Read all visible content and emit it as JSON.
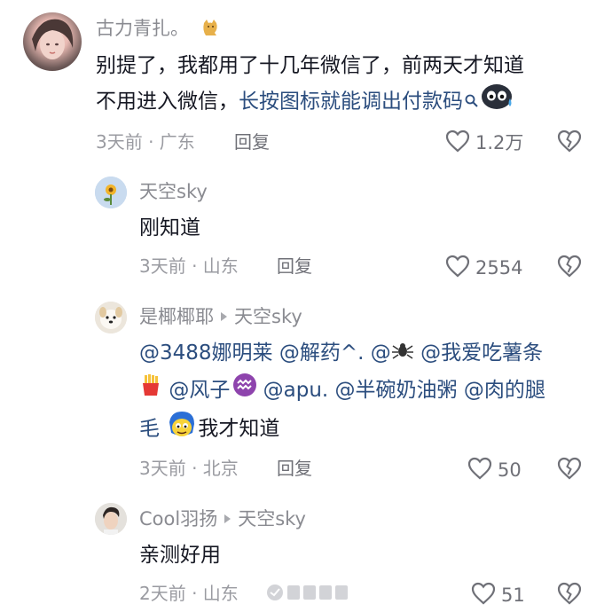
{
  "comments": [
    {
      "username": "古力青扎。",
      "text_line1": "别提了，我都用了十几年微信了，前两天才知道",
      "text_line2_prefix": "不用进入微信，",
      "text_line2_link": "长按图标就能调出付款码",
      "time_location": "3天前 · 广东",
      "reply_label": "回复",
      "likes": "1.2万"
    },
    {
      "username": "天空sky",
      "text": "刚知道",
      "time_location": "3天前 · 山东",
      "reply_label": "回复",
      "likes": "2554"
    },
    {
      "username": "是椰椰耶",
      "reply_to": "天空sky",
      "mentions_line1": [
        "@3488娜明莱",
        "@解药^.",
        "@",
        "@我爱吃薯条"
      ],
      "mentions_line2": [
        "@风子",
        "@apu.",
        "@半碗奶油粥",
        "@肉的腿"
      ],
      "line3_prefix": "毛",
      "line3_text": "我才知道",
      "time_location": "3天前 · 北京",
      "reply_label": "回复",
      "likes": "50"
    },
    {
      "username": "Cool羽扬",
      "reply_to": "天空sky",
      "text": "亲测好用",
      "time_location": "2天前 · 山东",
      "reply_label": "回复",
      "likes": "51"
    }
  ],
  "colors": {
    "text": "#161823",
    "secondary": "#8a8b91",
    "link": "#2b4d7e",
    "meta": "#9a9ba1"
  },
  "icons": [
    "heart-outline-icon",
    "broken-heart-icon",
    "search-icon",
    "play-arrow-icon"
  ]
}
